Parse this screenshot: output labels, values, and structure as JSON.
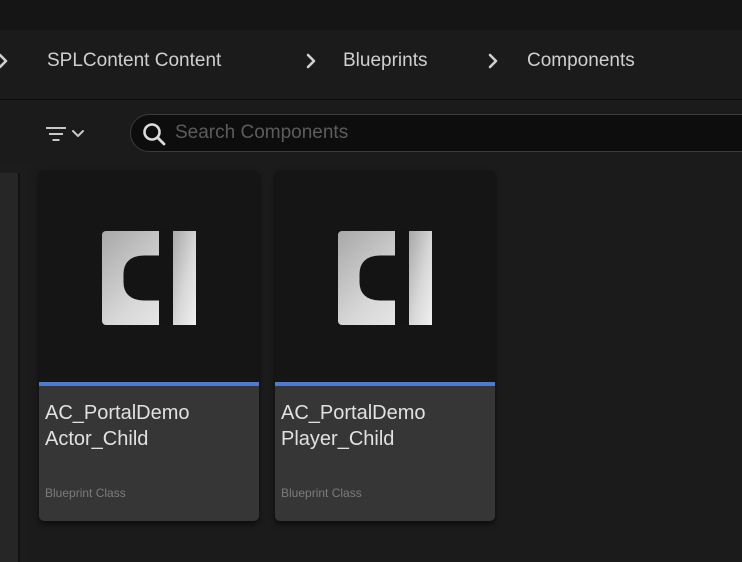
{
  "breadcrumb": {
    "items": [
      {
        "label": "SPLContent Content"
      },
      {
        "label": "Blueprints"
      },
      {
        "label": "Components"
      }
    ]
  },
  "toolbar": {
    "filter_icon": "filter-icon",
    "filter_dropdown_icon": "chevron-down-icon"
  },
  "search": {
    "placeholder": "Search Components",
    "value": "",
    "icon": "search-icon"
  },
  "assets": [
    {
      "name": "AC_PortalDemo\nActor_Child",
      "type": "Blueprint Class",
      "icon": "component-blueprint-icon"
    },
    {
      "name": "AC_PortalDemo\nPlayer_Child",
      "type": "Blueprint Class",
      "icon": "component-blueprint-icon"
    }
  ],
  "colors": {
    "accent_stripe": "#4f7ad1",
    "background": "#1b1b1b",
    "tile_info": "#363636"
  }
}
